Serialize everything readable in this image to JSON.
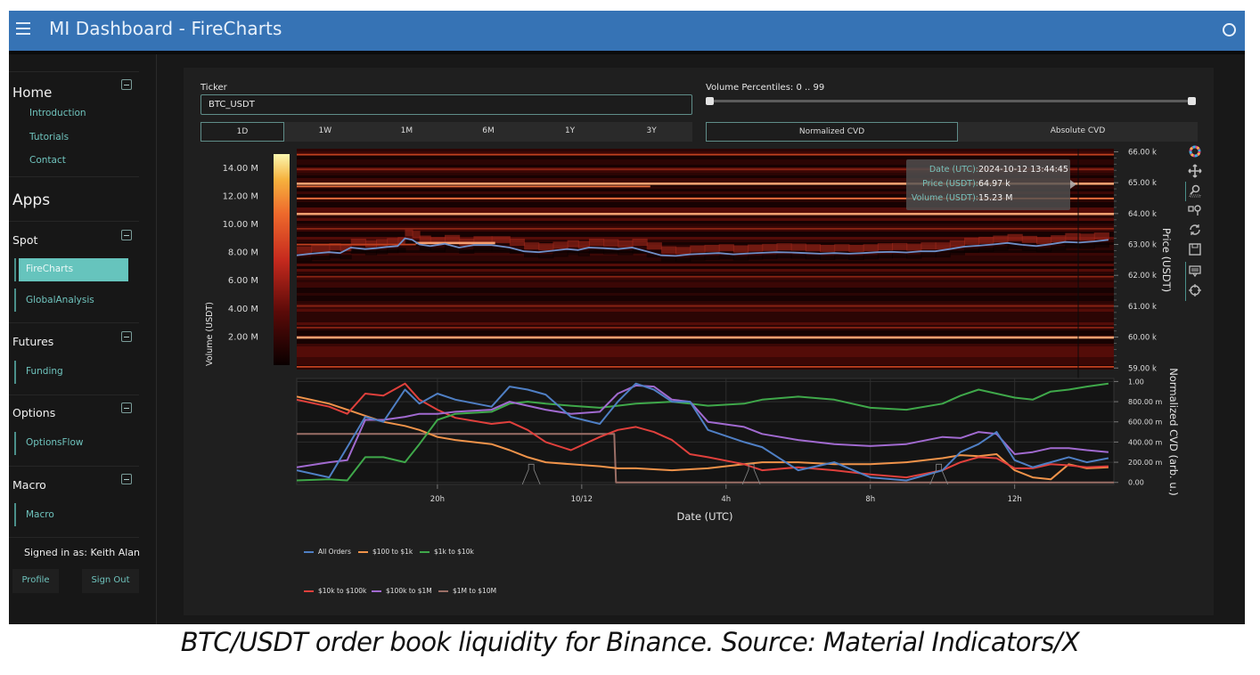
{
  "header": {
    "title": "MI Dashboard  -  FireCharts",
    "menu_icon": "hamburger-icon",
    "right_icon": "circle-icon"
  },
  "sidebar": {
    "home": {
      "label": "Home",
      "items": [
        "Introduction",
        "Tutorials",
        "Contact"
      ]
    },
    "apps_label": "Apps",
    "sections": [
      {
        "label": "Spot",
        "items": [
          "FireCharts",
          "GlobalAnalysis"
        ],
        "active": "FireCharts"
      },
      {
        "label": "Futures",
        "items": [
          "Funding"
        ]
      },
      {
        "label": "Options",
        "items": [
          "OptionsFlow"
        ]
      },
      {
        "label": "Macro",
        "items": [
          "Macro"
        ]
      }
    ],
    "signed_in": "Signed in as: Keith Alan",
    "profile_label": "Profile",
    "signout_label": "Sign Out"
  },
  "controls": {
    "ticker_label": "Ticker",
    "ticker_value": "BTC_USDT",
    "ranges": [
      "1D",
      "1W",
      "1M",
      "6M",
      "1Y",
      "3Y"
    ],
    "active_range": "1D",
    "volume_percentiles_label": "Volume Percentiles: 0 .. 99",
    "volume_percentiles_range": [
      0,
      99
    ],
    "cvd_modes": [
      "Normalized CVD",
      "Absolute CVD"
    ],
    "active_cvd_mode": "Normalized CVD"
  },
  "tooltip": {
    "date_key": "Date (UTC):",
    "date_val": "2024-10-12 13:44:45",
    "price_key": "Price (USDT):",
    "price_val": "64.97 k",
    "volume_key": "Volume (USDT):",
    "volume_val": "15.23 M"
  },
  "modebar_icons": [
    "plotly-logo-icon",
    "pan-icon",
    "zoom-icon",
    "zoom-in-out-icon",
    "reset-icon",
    "download-icon",
    "spike-lines-icon",
    "crosshair-icon"
  ],
  "colors": {
    "accent": "#66c4bd",
    "header": "#3673b5",
    "all_orders": "#4f7fc4",
    "r100_1k": "#f0934a",
    "r1k_10k": "#3fa84a",
    "r10k_100k": "#e0403c",
    "r100k_1m": "#a16ad0",
    "r1m_10m": "#9a6e66"
  },
  "caption": "BTC/USDT order book liquidity for Binance. Source: Material Indicators/X",
  "chart_data": [
    {
      "type": "heatmap",
      "title": "",
      "xlabel": "Date (UTC)",
      "ylabel": "Price (USDT)",
      "colorbar_label": "Volume (USDT)",
      "colorbar_ticks": [
        "2.00 M",
        "4.00 M",
        "6.00 M",
        "8.00 M",
        "10.00 M",
        "12.00 M",
        "14.00 M"
      ],
      "colorbar_range": [
        0,
        15000000
      ],
      "y_ticks": [
        "59.00 k",
        "60.00 k",
        "61.00 k",
        "62.00 k",
        "63.00 k",
        "64.00 k",
        "65.00 k",
        "66.00 k"
      ],
      "ylim": [
        58950,
        66100
      ],
      "x_range_hours": [
        16.1,
        38.75
      ],
      "x_ticks": [
        {
          "h": 20,
          "label": "20h"
        },
        {
          "h": 24,
          "label": "10/12"
        },
        {
          "h": 28,
          "label": "4h"
        },
        {
          "h": 32,
          "label": "8h"
        },
        {
          "h": 36,
          "label": "12h"
        }
      ],
      "liquidity_bands": [
        {
          "price": 65900,
          "intensity": 0.55,
          "from_h": 16.1,
          "to_h": 38.75
        },
        {
          "price": 65420,
          "intensity": 0.35,
          "from_h": 16.1,
          "to_h": 38.75
        },
        {
          "price": 64970,
          "intensity": 0.95,
          "from_h": 16.1,
          "to_h": 38.75
        },
        {
          "price": 64870,
          "intensity": 0.85,
          "from_h": 16.1,
          "to_h": 25.9
        },
        {
          "price": 64480,
          "intensity": 0.75,
          "from_h": 16.1,
          "to_h": 38.75
        },
        {
          "price": 63990,
          "intensity": 0.9,
          "from_h": 16.1,
          "to_h": 38.75
        },
        {
          "price": 63500,
          "intensity": 0.4,
          "from_h": 16.1,
          "to_h": 38.75
        },
        {
          "price": 63050,
          "intensity": 0.95,
          "from_h": 19.4,
          "to_h": 21.6
        },
        {
          "price": 62990,
          "intensity": 0.5,
          "from_h": 16.1,
          "to_h": 19.4
        },
        {
          "price": 61950,
          "intensity": 0.35,
          "from_h": 16.1,
          "to_h": 38.75
        },
        {
          "price": 61000,
          "intensity": 0.3,
          "from_h": 16.1,
          "to_h": 38.75
        },
        {
          "price": 60300,
          "intensity": 0.35,
          "from_h": 16.1,
          "to_h": 38.75
        },
        {
          "price": 59990,
          "intensity": 0.95,
          "from_h": 16.1,
          "to_h": 38.75
        },
        {
          "price": 59030,
          "intensity": 0.6,
          "from_h": 16.1,
          "to_h": 38.75
        }
      ],
      "price_series": {
        "name": "Price",
        "hours": [
          16.1,
          16.5,
          17.0,
          17.3,
          17.6,
          18.0,
          18.3,
          18.6,
          18.9,
          19.1,
          19.3,
          19.5,
          19.8,
          20.2,
          20.6,
          21.0,
          21.5,
          22.0,
          22.4,
          22.8,
          23.2,
          23.6,
          23.9,
          24.2,
          24.6,
          25.0,
          25.4,
          25.8,
          26.2,
          26.6,
          27.0,
          27.4,
          27.8,
          28.2,
          28.6,
          29.0,
          29.4,
          29.8,
          30.2,
          30.6,
          31.0,
          31.4,
          31.8,
          32.2,
          32.6,
          33.0,
          33.4,
          33.8,
          34.2,
          34.6,
          35.0,
          35.4,
          35.8,
          36.2,
          36.6,
          37.0,
          37.4,
          37.8,
          38.2,
          38.6
        ],
        "prices": [
          62650,
          62700,
          62750,
          62720,
          62900,
          62850,
          62880,
          62920,
          62950,
          63200,
          63150,
          63000,
          62950,
          63020,
          62900,
          62980,
          62980,
          62900,
          62780,
          62750,
          62800,
          62850,
          62820,
          62900,
          62880,
          62850,
          62900,
          62780,
          62650,
          62630,
          62680,
          62700,
          62720,
          62680,
          62710,
          62730,
          62750,
          62740,
          62720,
          62700,
          62720,
          62700,
          62720,
          62750,
          62760,
          62740,
          62780,
          62780,
          62850,
          62930,
          62960,
          63000,
          63050,
          62990,
          62950,
          63010,
          63080,
          63060,
          63100,
          63150
        ]
      }
    },
    {
      "type": "line",
      "title": "",
      "xlabel": "Date (UTC)",
      "ylabel": "Normalized CVD (arb. u.)",
      "y_ticks": [
        "0.00",
        "200.00 m",
        "400.00 m",
        "600.00 m",
        "800.00 m",
        "1.00"
      ],
      "ylim": [
        -0.02,
        1.03
      ],
      "x_range_hours": [
        16.1,
        38.75
      ],
      "x_ticks": [
        {
          "h": 20,
          "label": "20h"
        },
        {
          "h": 24,
          "label": "10/12"
        },
        {
          "h": 28,
          "label": "4h"
        },
        {
          "h": 32,
          "label": "8h"
        },
        {
          "h": 36,
          "label": "12h"
        }
      ],
      "legend_position": "bottom-left",
      "x_hours": [
        16.1,
        17.0,
        17.5,
        18.0,
        18.5,
        19.1,
        19.5,
        20.0,
        20.5,
        21.5,
        22.0,
        22.5,
        23.0,
        23.7,
        24.5,
        25.0,
        25.5,
        26.0,
        26.5,
        27.0,
        27.5,
        28.5,
        29.0,
        30.0,
        31.0,
        32.0,
        33.0,
        34.0,
        34.5,
        35.0,
        35.5,
        36.0,
        36.5,
        37.0,
        37.5,
        38.0,
        38.6
      ],
      "series": [
        {
          "name": "All Orders",
          "values": [
            0.12,
            0.05,
            0.35,
            0.65,
            0.6,
            0.92,
            0.78,
            0.88,
            0.82,
            0.75,
            0.95,
            0.92,
            0.87,
            0.65,
            0.58,
            0.8,
            0.98,
            0.92,
            0.8,
            0.8,
            0.52,
            0.4,
            0.35,
            0.12,
            0.2,
            0.05,
            0.02,
            0.12,
            0.3,
            0.38,
            0.5,
            0.22,
            0.15,
            0.2,
            0.25,
            0.2,
            0.24
          ]
        },
        {
          "name": "$100 to $1k",
          "values": [
            0.85,
            0.78,
            0.72,
            0.66,
            0.6,
            0.56,
            0.52,
            0.45,
            0.42,
            0.38,
            0.32,
            0.25,
            0.2,
            0.18,
            0.16,
            0.14,
            0.14,
            0.13,
            0.12,
            0.13,
            0.14,
            0.18,
            0.2,
            0.2,
            0.18,
            0.18,
            0.2,
            0.24,
            0.27,
            0.26,
            0.28,
            0.12,
            0.05,
            0.03,
            0.18,
            0.14,
            0.15
          ]
        },
        {
          "name": "$1k to $10k",
          "values": [
            0.02,
            0.03,
            0.02,
            0.25,
            0.25,
            0.2,
            0.38,
            0.62,
            0.68,
            0.7,
            0.78,
            0.8,
            0.78,
            0.76,
            0.74,
            0.76,
            0.78,
            0.79,
            0.8,
            0.78,
            0.76,
            0.78,
            0.82,
            0.85,
            0.82,
            0.74,
            0.72,
            0.78,
            0.86,
            0.92,
            0.88,
            0.84,
            0.82,
            0.9,
            0.92,
            0.95,
            0.98
          ]
        },
        {
          "name": "$10k to $100k",
          "values": [
            0.82,
            0.75,
            0.68,
            0.88,
            0.86,
            0.98,
            0.82,
            0.72,
            0.64,
            0.58,
            0.6,
            0.52,
            0.4,
            0.32,
            0.45,
            0.52,
            0.55,
            0.5,
            0.42,
            0.28,
            0.25,
            0.18,
            0.12,
            0.15,
            0.12,
            0.08,
            0.05,
            0.12,
            0.2,
            0.25,
            0.24,
            0.14,
            0.14,
            0.18,
            0.17,
            0.15,
            0.16
          ]
        },
        {
          "name": "$100k to $1M",
          "values": [
            0.15,
            0.2,
            0.22,
            0.62,
            0.62,
            0.65,
            0.68,
            0.68,
            0.7,
            0.72,
            0.8,
            0.76,
            0.72,
            0.68,
            0.7,
            0.88,
            0.96,
            0.95,
            0.82,
            0.8,
            0.6,
            0.55,
            0.48,
            0.42,
            0.38,
            0.36,
            0.38,
            0.45,
            0.44,
            0.5,
            0.48,
            0.28,
            0.3,
            0.34,
            0.34,
            0.32,
            0.3
          ]
        },
        {
          "name": "$1M to $10M",
          "values": [
            0.48,
            0.48,
            0.48,
            0.48,
            0.48,
            0.48,
            0.48,
            0.48,
            0.48,
            0.48,
            0.48,
            0.48,
            0.48,
            0.48,
            0.48,
            0.0,
            0.0,
            0.0,
            0.0,
            0.0,
            0.0,
            0.0,
            0.0,
            0.0,
            0.0,
            0.0,
            0.0,
            0.0,
            0.0,
            0.0,
            0.0,
            0.0,
            0.0,
            0.0,
            0.0,
            0.0,
            0.0
          ]
        }
      ]
    }
  ]
}
